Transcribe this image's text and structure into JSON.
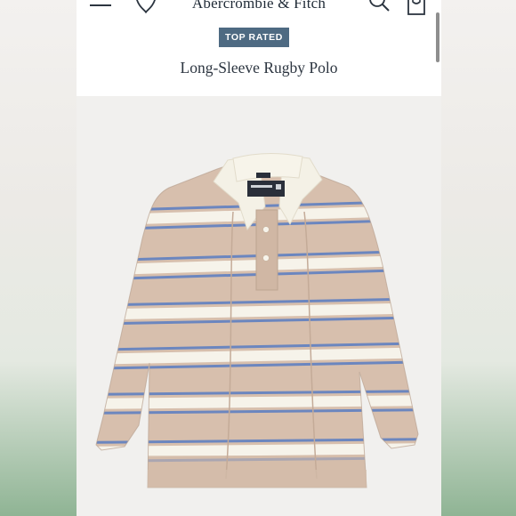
{
  "header": {
    "brand": "Abercrombie & Fitch",
    "menu_icon": "menu-icon",
    "wishlist_icon": "heart-icon",
    "search_icon": "search-icon",
    "bag_icon": "shopping-bag-icon"
  },
  "product": {
    "badge": "TOP RATED",
    "name": "Long-Sleeve Rugby Polo",
    "image_description": "tan rugby polo with white and blue stripes and white collar"
  },
  "colors": {
    "badge_bg": "#4e6a82",
    "shirt_tan": "#d7bfad",
    "stripe_white": "#f6f3ea",
    "stripe_blue": "#6b86bf",
    "collar": "#f4f1e6"
  }
}
